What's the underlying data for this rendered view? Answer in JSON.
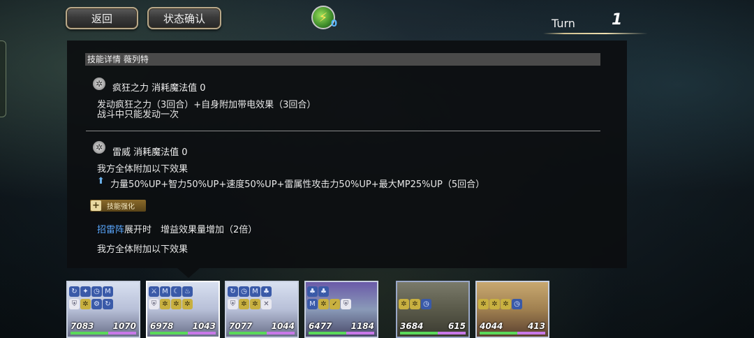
{
  "header": {
    "back_label": "返回",
    "status_label": "状态确认",
    "energy_count": "0",
    "turn_label": "Turn",
    "turn_number": "1"
  },
  "panel": {
    "title": "技能详情 薇列特",
    "skill1": {
      "title": "疯狂之力 消耗魔法值 0",
      "line1": "发动疯狂之力（3回合）+自身附加带电效果（3回合）",
      "line2": "战斗中只能发动一次"
    },
    "skill2": {
      "title": "雷威 消耗魔法值 0",
      "line1": "我方全体附加以下效果",
      "line2": "力量50%UP+智力50%UP+速度50%UP+雷属性攻击力50%UP+最大MP25%UP（5回合）"
    },
    "enhance": {
      "badge_label": "技能强化",
      "link_text": "招雷阵",
      "line_rest": "展开时　增益效果量增加（2倍）",
      "line2": "我方全体附加以下效果"
    }
  },
  "party": [
    {
      "hp": "7083",
      "mp": "1070"
    },
    {
      "hp": "6978",
      "mp": "1043"
    },
    {
      "hp": "7077",
      "mp": "1044"
    },
    {
      "hp": "6477",
      "mp": "1184"
    },
    {
      "hp": "3684",
      "mp": "615"
    },
    {
      "hp": "4044",
      "mp": "413"
    }
  ]
}
